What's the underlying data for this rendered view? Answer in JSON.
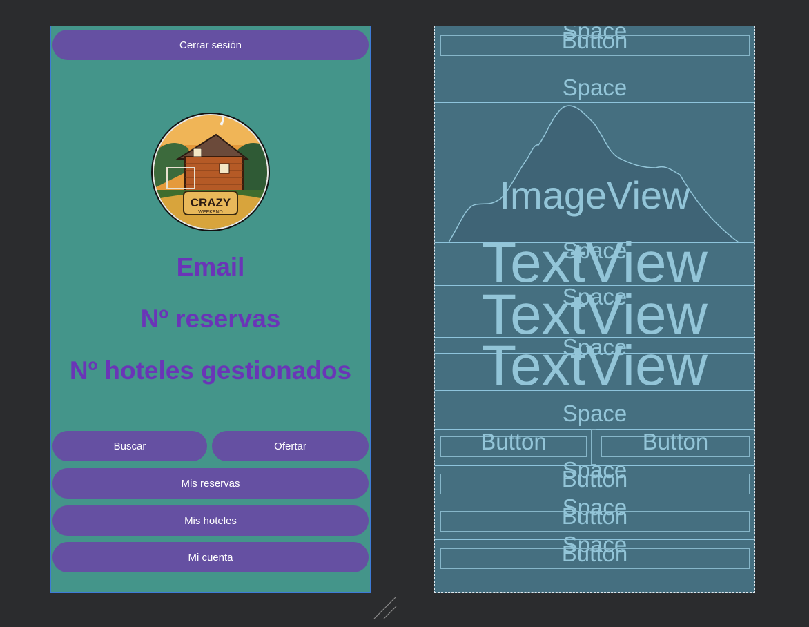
{
  "design": {
    "logout_button": "Cerrar sesión",
    "email_label": "Email",
    "reservations_label": "Nº reservas",
    "hotels_label": "Nº hoteles gestionados",
    "search_button": "Buscar",
    "offer_button": "Ofertar",
    "my_reservations_button": "Mis reservas",
    "my_hotels_button": "Mis hoteles",
    "my_account_button": "Mi cuenta",
    "logo_text": "CRAZY WEEKEND"
  },
  "blueprint": {
    "space": "Space",
    "button": "Button",
    "image_view": "ImageView",
    "text_view": "TextView"
  },
  "colors": {
    "canvas_bg": "#2b2c2e",
    "design_bg": "#44958a",
    "button_bg": "#6550a2",
    "title_text": "#6a35b7",
    "blueprint_bg": "#456f80",
    "blueprint_text": "#93c5d8"
  }
}
